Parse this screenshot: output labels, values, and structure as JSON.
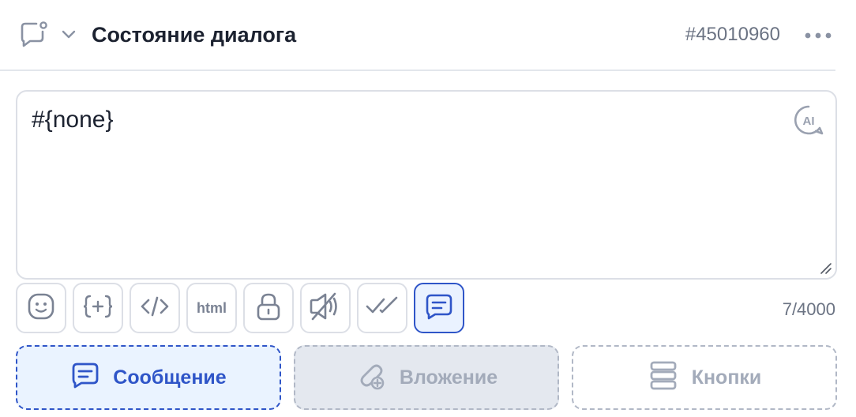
{
  "header": {
    "title": "Состояние диалога",
    "dialog_id": "#45010960",
    "icon": "chat-bubble-dot-icon",
    "chevron_icon": "chevron-down-icon",
    "more_icon": "more-horizontal-icon"
  },
  "editor": {
    "value": "#{none}",
    "ai_badge": "AI"
  },
  "toolbar": {
    "items": [
      {
        "icon": "emoji-icon"
      },
      {
        "icon": "variable-icon",
        "glyph": "{+}"
      },
      {
        "icon": "code-icon",
        "glyph": "</>"
      },
      {
        "icon": "html-icon",
        "label": "html"
      },
      {
        "icon": "lock-icon"
      },
      {
        "icon": "mute-sound-icon"
      },
      {
        "icon": "double-check-icon"
      },
      {
        "icon": "message-icon",
        "active": true
      }
    ],
    "counter": "7/4000"
  },
  "add_buttons": {
    "message_label": "Сообщение",
    "attachment_label": "Вложение",
    "buttons_label": "Кнопки"
  },
  "colors": {
    "accent": "#2f55c8",
    "accent_bg": "#eaf3ff",
    "muted": "#a3abba",
    "border": "#dcdfe6"
  }
}
